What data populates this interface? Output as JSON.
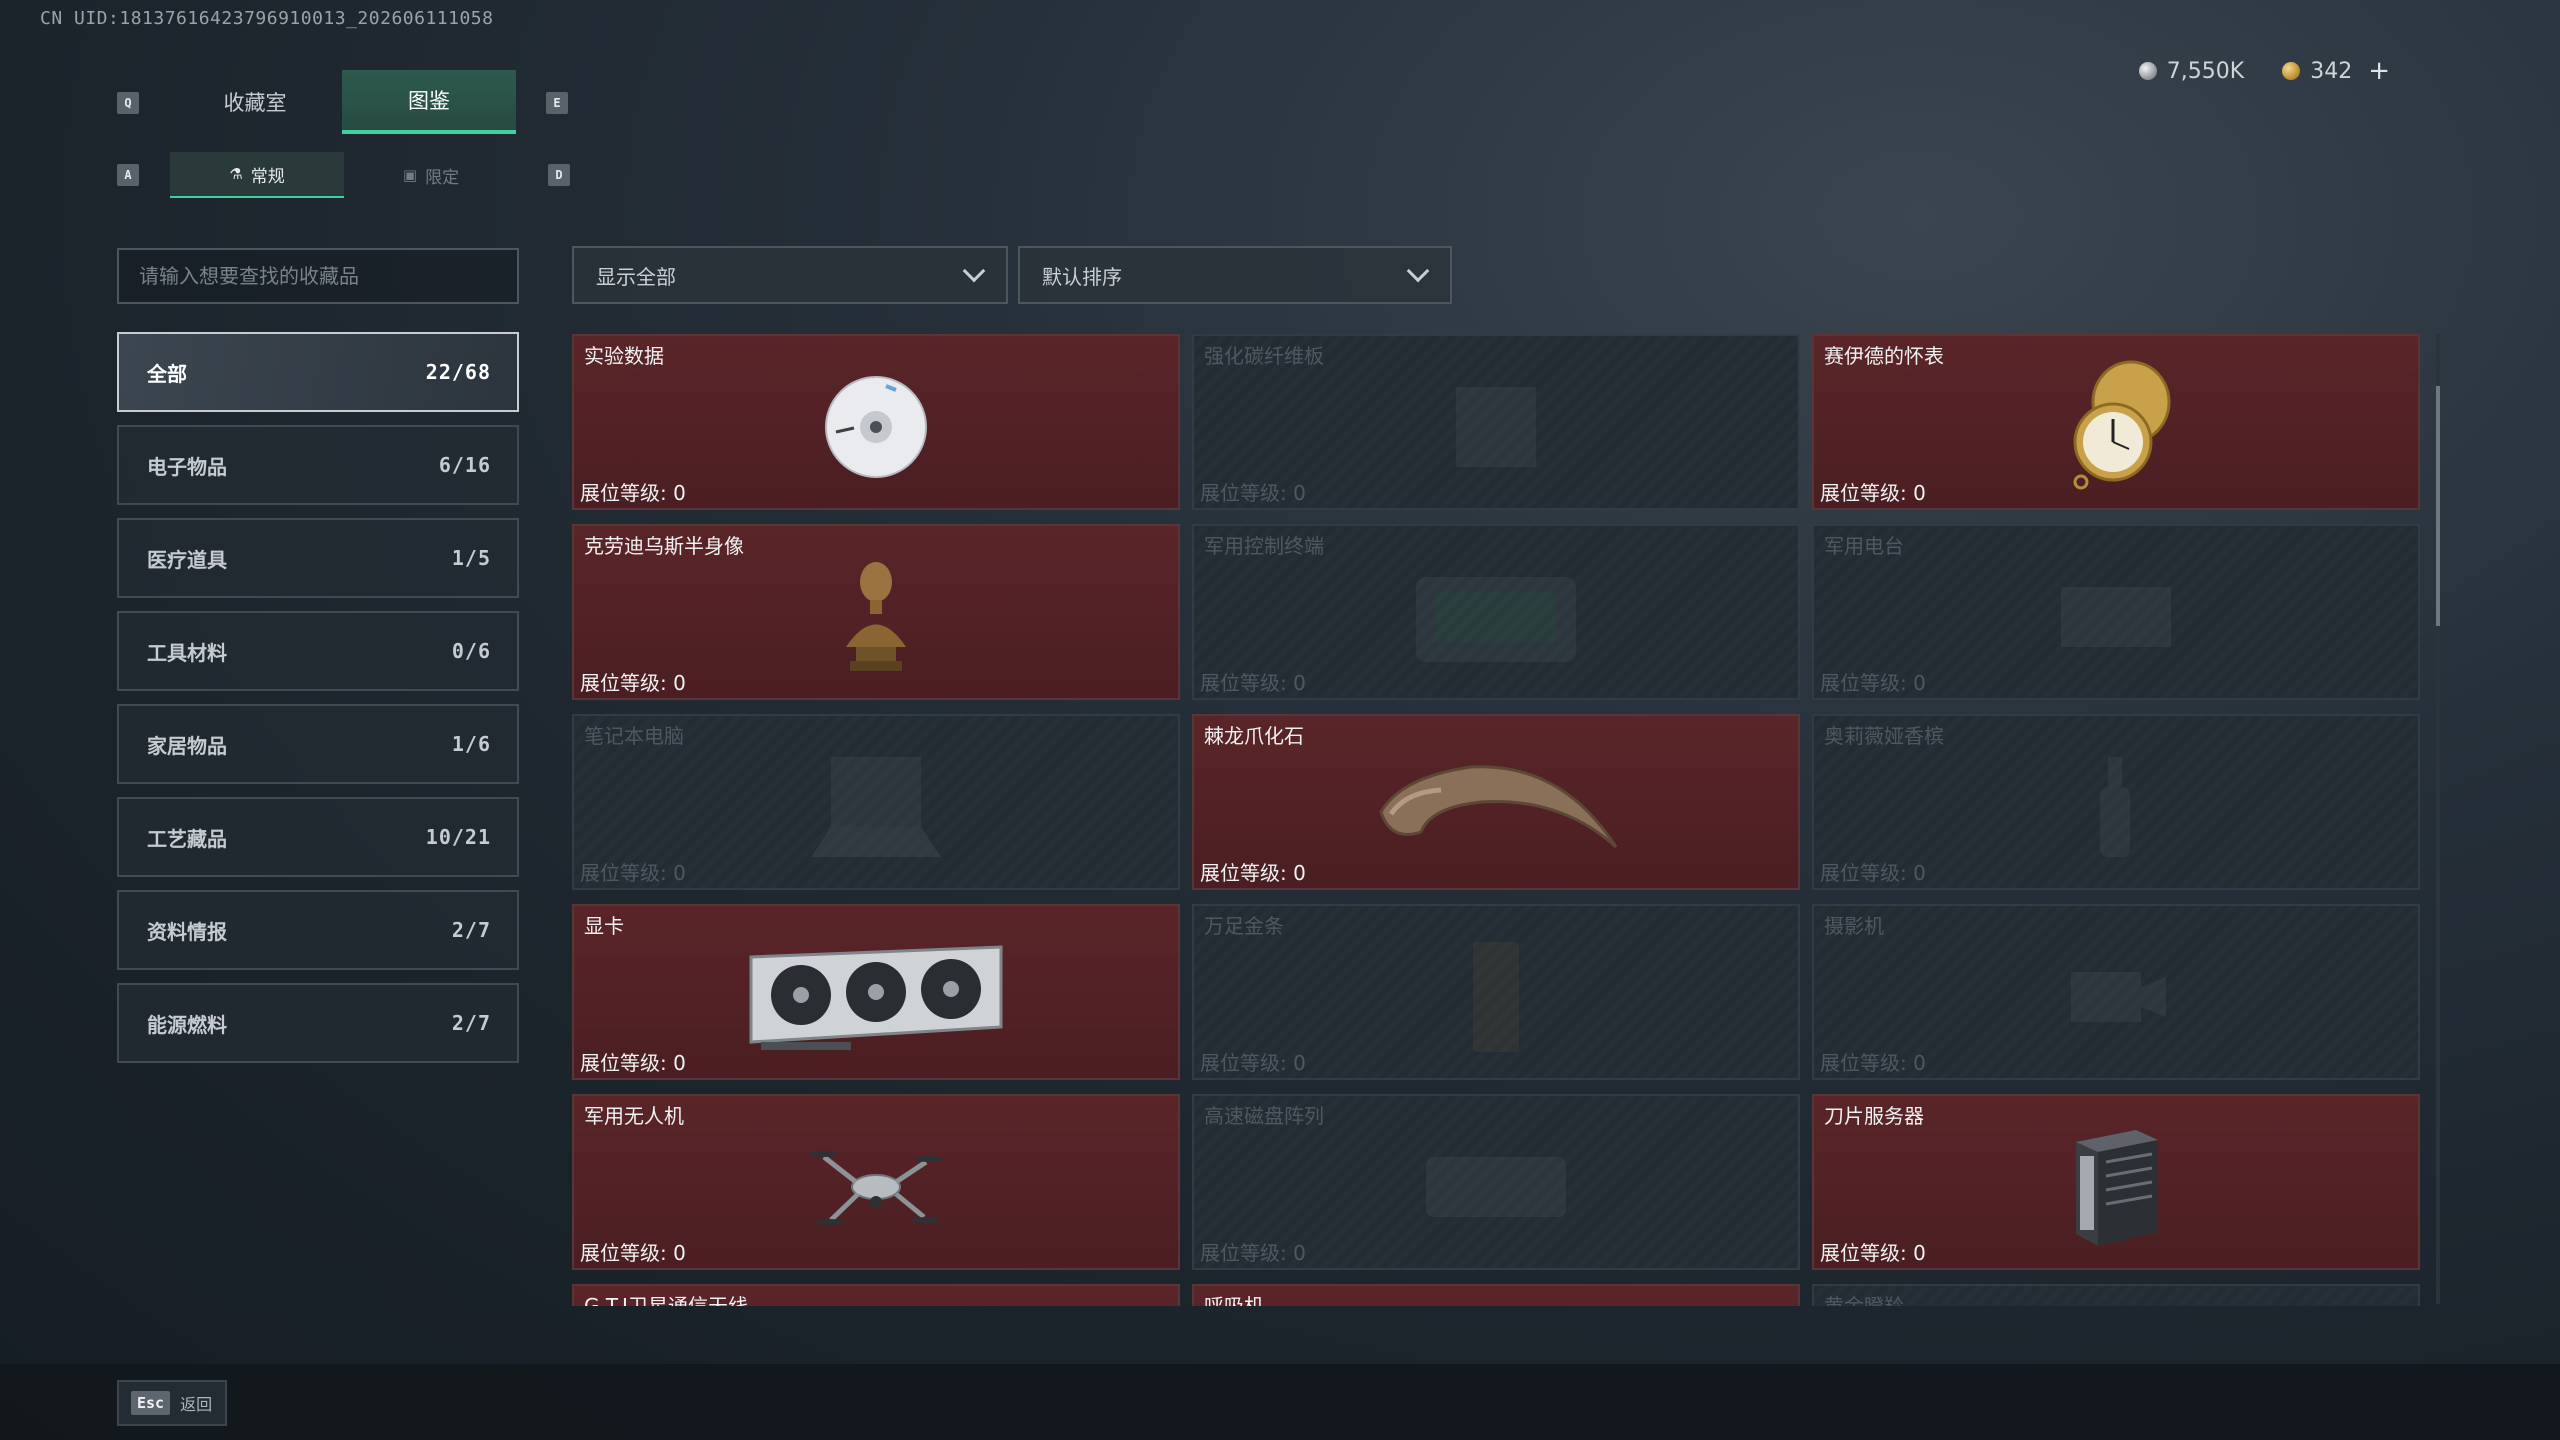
{
  "uid": "CN UID:18137616423796910013_202606111058",
  "currency": {
    "silver": "7,550K",
    "gold": "342",
    "plus": "+"
  },
  "keys": {
    "prev_tab": "Q",
    "next_tab": "E",
    "prev_sub": "A",
    "next_sub": "D"
  },
  "tabs": [
    {
      "label": "收藏室",
      "active": false
    },
    {
      "label": "图鉴",
      "active": true
    }
  ],
  "sub_tabs": [
    {
      "label": "常规",
      "icon": "bottle-icon",
      "active": true
    },
    {
      "label": "限定",
      "icon": "image-icon",
      "active": false
    }
  ],
  "search": {
    "placeholder": "请输入想要查找的收藏品",
    "value": ""
  },
  "filter": {
    "selected": "显示全部"
  },
  "sort": {
    "selected": "默认排序"
  },
  "categories": [
    {
      "label": "全部",
      "count": "22/68",
      "active": true
    },
    {
      "label": "电子物品",
      "count": "6/16"
    },
    {
      "label": "医疗道具",
      "count": "1/5"
    },
    {
      "label": "工具材料",
      "count": "0/6"
    },
    {
      "label": "家居物品",
      "count": "1/6"
    },
    {
      "label": "工艺藏品",
      "count": "10/21"
    },
    {
      "label": "资料情报",
      "count": "2/7"
    },
    {
      "label": "能源燃料",
      "count": "2/7"
    }
  ],
  "items": [
    {
      "name": "实验数据",
      "level": "展位等级: 0",
      "owned": true,
      "icon": "disc-icon"
    },
    {
      "name": "强化碳纤维板",
      "level": "展位等级: 0",
      "owned": false,
      "icon": "carbon-plate-icon"
    },
    {
      "name": "赛伊德的怀表",
      "level": "展位等级: 0",
      "owned": true,
      "icon": "pocket-watch-icon"
    },
    {
      "name": "克劳迪乌斯半身像",
      "level": "展位等级: 0",
      "owned": true,
      "icon": "bust-icon"
    },
    {
      "name": "军用控制终端",
      "level": "展位等级: 0",
      "owned": false,
      "icon": "control-terminal-icon"
    },
    {
      "name": "军用电台",
      "level": "展位等级: 0",
      "owned": false,
      "icon": "radio-icon"
    },
    {
      "name": "笔记本电脑",
      "level": "展位等级: 0",
      "owned": false,
      "icon": "laptop-icon"
    },
    {
      "name": "棘龙爪化石",
      "level": "展位等级: 0",
      "owned": true,
      "icon": "claw-fossil-icon"
    },
    {
      "name": "奥莉薇娅香槟",
      "level": "展位等级: 0",
      "owned": false,
      "icon": "champagne-icon"
    },
    {
      "name": "显卡",
      "level": "展位等级: 0",
      "owned": true,
      "icon": "graphics-card-icon"
    },
    {
      "name": "万足金条",
      "level": "展位等级: 0",
      "owned": false,
      "icon": "gold-bar-icon"
    },
    {
      "name": "摄影机",
      "level": "展位等级: 0",
      "owned": false,
      "icon": "camera-icon"
    },
    {
      "name": "军用无人机",
      "level": "展位等级: 0",
      "owned": true,
      "icon": "drone-icon"
    },
    {
      "name": "高速磁盘阵列",
      "level": "展位等级: 0",
      "owned": false,
      "icon": "disk-array-icon"
    },
    {
      "name": "刀片服务器",
      "level": "展位等级: 0",
      "owned": true,
      "icon": "blade-server-icon"
    },
    {
      "name": "G.T.I卫星通信天线",
      "level": "",
      "owned": true,
      "icon": "satellite-antenna-icon"
    },
    {
      "name": "呼吸机",
      "level": "",
      "owned": true,
      "icon": "ventilator-icon"
    },
    {
      "name": "黄金瞪羚",
      "level": "",
      "owned": false,
      "icon": "gazelle-icon"
    }
  ],
  "bottom": {
    "esc_key": "Esc",
    "esc_label": "返回"
  },
  "colors": {
    "accent": "#3fd1a0",
    "owned_card": "#4e2024",
    "locked_card": "#242c34"
  }
}
